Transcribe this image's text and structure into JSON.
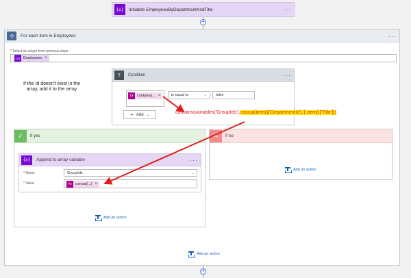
{
  "init_step": {
    "icon": "variable-icon",
    "icon_glyph": "{x}",
    "title": "Initialize EmployeesByDepartmentAndTitle"
  },
  "foreach": {
    "title": "For each item in Employees",
    "select_label": "Select an output from previous steps",
    "token_label": "Employees",
    "token_remove": "×"
  },
  "condition": {
    "title": "Condition",
    "left_token": "contains(...",
    "token_remove": "×",
    "operator": "is equal to",
    "value": "false",
    "add_label": "Add"
  },
  "annotation": {
    "text": "If the Id doesn't exist in the array, add it to the array"
  },
  "formula": {
    "part1": "contains(variables('GroupIds'),",
    "part2": "concat(item()['DepartmentId'],'|',item()['Title']))"
  },
  "if_yes": {
    "title": "If yes",
    "add_action": "Add an action"
  },
  "if_no": {
    "title": "If no",
    "add_action": "Add an action"
  },
  "append": {
    "title": "Append to array variable",
    "name_label": "Name",
    "name_value": "GroupIds",
    "value_label": "Value",
    "value_token": "concat(...)",
    "token_remove": "×"
  },
  "foreach_add_action": "Add an action",
  "fx_glyph": "fx",
  "colors": {
    "variable_accent": "#770bd6",
    "loop_accent": "#486991",
    "condition_accent": "#484f58",
    "yes_accent": "#6bbd5f",
    "no_accent": "#f28b8b",
    "expression_token": "#ad008c",
    "callout_red": "#e01e1e",
    "link_blue": "#0a5fb4"
  }
}
